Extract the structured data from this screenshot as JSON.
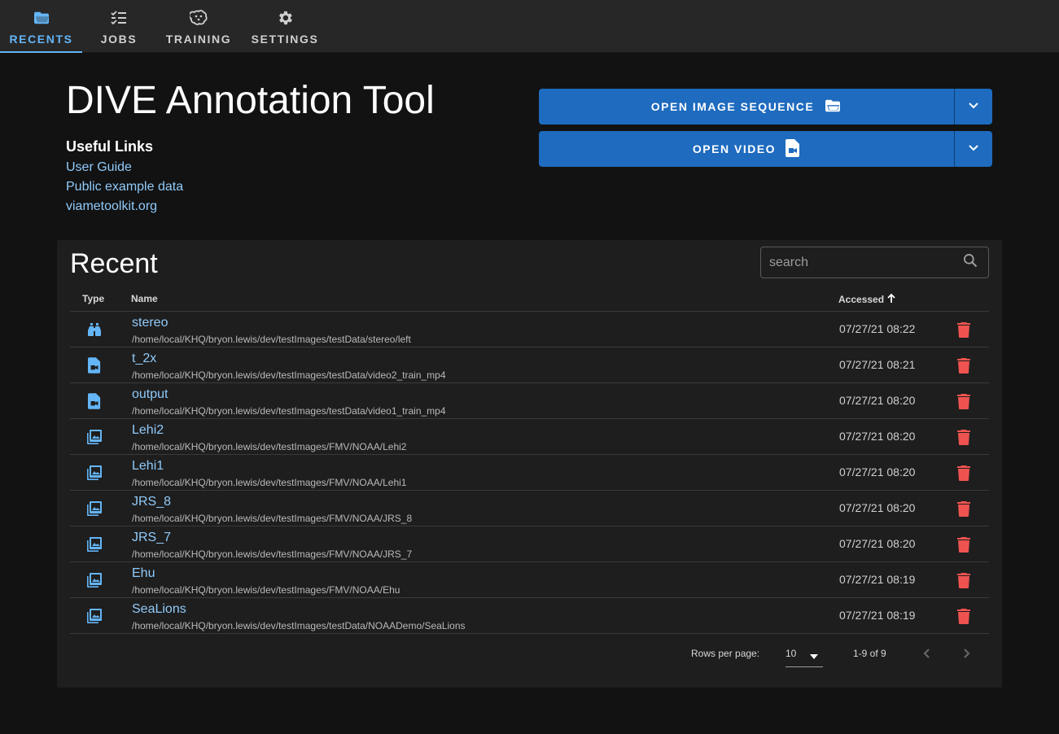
{
  "nav": {
    "tabs": [
      {
        "label": "RECENTS",
        "icon": "folder-open-icon",
        "active": true
      },
      {
        "label": "JOBS",
        "icon": "format-list-checks-icon",
        "active": false
      },
      {
        "label": "TRAINING",
        "icon": "brain-icon",
        "active": false
      },
      {
        "label": "SETTINGS",
        "icon": "gear-icon",
        "active": false
      }
    ]
  },
  "header": {
    "title": "DIVE Annotation Tool",
    "useful_links_title": "Useful Links",
    "links": [
      "User Guide",
      "Public example data",
      "viametoolkit.org"
    ]
  },
  "actions": {
    "open_image_sequence": "OPEN IMAGE SEQUENCE",
    "open_video": "OPEN VIDEO"
  },
  "recent": {
    "title": "Recent",
    "search_placeholder": "search",
    "columns": {
      "type": "Type",
      "name": "Name",
      "accessed": "Accessed"
    },
    "rows": [
      {
        "type": "stereo",
        "icon": "binoculars-icon",
        "name": "stereo",
        "path": "/home/local/KHQ/bryon.lewis/dev/testImages/testData/stereo/left",
        "accessed": "07/27/21 08:22"
      },
      {
        "type": "video",
        "icon": "file-video-icon",
        "name": "t_2x",
        "path": "/home/local/KHQ/bryon.lewis/dev/testImages/testData/video2_train_mp4",
        "accessed": "07/27/21 08:21"
      },
      {
        "type": "video",
        "icon": "file-video-icon",
        "name": "output",
        "path": "/home/local/KHQ/bryon.lewis/dev/testImages/testData/video1_train_mp4",
        "accessed": "07/27/21 08:20"
      },
      {
        "type": "image-sequence",
        "icon": "image-multiple-icon",
        "name": "Lehi2",
        "path": "/home/local/KHQ/bryon.lewis/dev/testImages/FMV/NOAA/Lehi2",
        "accessed": "07/27/21 08:20"
      },
      {
        "type": "image-sequence",
        "icon": "image-multiple-icon",
        "name": "Lehi1",
        "path": "/home/local/KHQ/bryon.lewis/dev/testImages/FMV/NOAA/Lehi1",
        "accessed": "07/27/21 08:20"
      },
      {
        "type": "image-sequence",
        "icon": "image-multiple-icon",
        "name": "JRS_8",
        "path": "/home/local/KHQ/bryon.lewis/dev/testImages/FMV/NOAA/JRS_8",
        "accessed": "07/27/21 08:20"
      },
      {
        "type": "image-sequence",
        "icon": "image-multiple-icon",
        "name": "JRS_7",
        "path": "/home/local/KHQ/bryon.lewis/dev/testImages/FMV/NOAA/JRS_7",
        "accessed": "07/27/21 08:20"
      },
      {
        "type": "image-sequence",
        "icon": "image-multiple-icon",
        "name": "Ehu",
        "path": "/home/local/KHQ/bryon.lewis/dev/testImages/FMV/NOAA/Ehu",
        "accessed": "07/27/21 08:19"
      },
      {
        "type": "image-sequence",
        "icon": "image-multiple-icon",
        "name": "SeaLions",
        "path": "/home/local/KHQ/bryon.lewis/dev/testImages/testData/NOAADemo/SeaLions",
        "accessed": "07/27/21 08:19"
      }
    ],
    "footer": {
      "rows_per_page_label": "Rows per page:",
      "rows_per_page_value": "10",
      "range": "1-9 of 9"
    }
  },
  "colors": {
    "accent": "#64b5f6",
    "link": "#90caf9",
    "primary_button": "#1e6bbf",
    "delete": "#ef5350",
    "type_icon": "#64b5f6"
  }
}
